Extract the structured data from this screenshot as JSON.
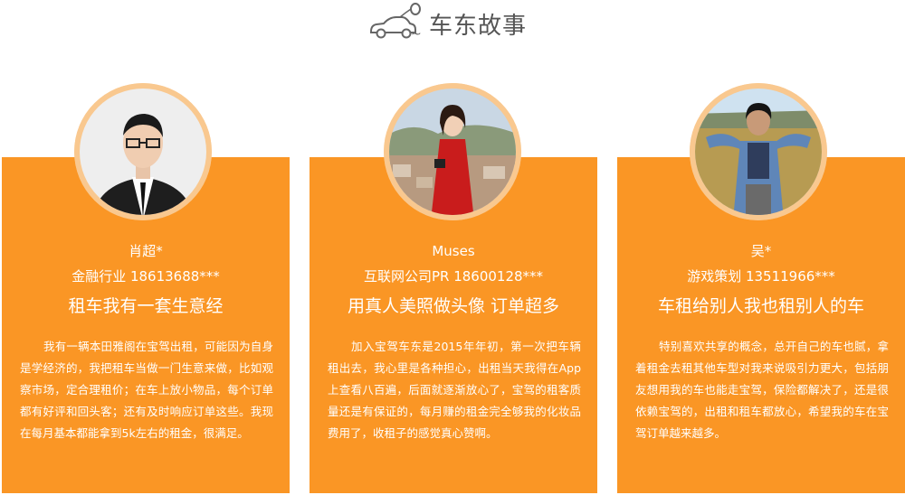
{
  "header": {
    "title": "车东故事",
    "tilde": "~",
    "icon": "car-balloon-icon"
  },
  "colors": {
    "card_bg": "#fa9625",
    "avatar_ring": "#f9c88f",
    "title_text": "#555555"
  },
  "cards": [
    {
      "name": "肖超*",
      "occupation": "金融行业 18613688***",
      "slogan": "租车我有一套生意经",
      "story": "我有一辆本田雅阁在宝驾出租，可能因为自身是学经济的，我把租车当做一门生意来做，比如观察市场，定合理租价；在车上放小物品，每个订单都有好评和回头客；还有及时响应订单这些。我现在每月基本都能拿到5k左右的租金，很满足。",
      "avatar": "man-with-glasses-portrait"
    },
    {
      "name": "Muses",
      "occupation": "互联网公司PR 18600128***",
      "slogan": "用真人美照做头像 订单超多",
      "story": "加入宝驾车东是2015年年初，第一次把车辆租出去，我心里是各种担心，出租当天我得在App上查看八百遍，后面就逐渐放心了，宝驾的租客质量还是有保证的，每月赚的租金完全够我的化妆品费用了，收租子的感觉真心赞啊。",
      "avatar": "woman-red-dress-portrait"
    },
    {
      "name": "吴*",
      "occupation": "游戏策划 13511966***",
      "slogan": "车租给别人我也租别人的车",
      "story": "特别喜欢共享的概念，总开自己的车也腻，拿着租金去租其他车型对我来说吸引力更大，包括朋友想用我的车也能走宝驾，保险都解决了，还是很依赖宝驾的，出租和租车都放心，希望我的车在宝驾订单越来越多。",
      "avatar": "young-man-grassland-portrait"
    }
  ]
}
